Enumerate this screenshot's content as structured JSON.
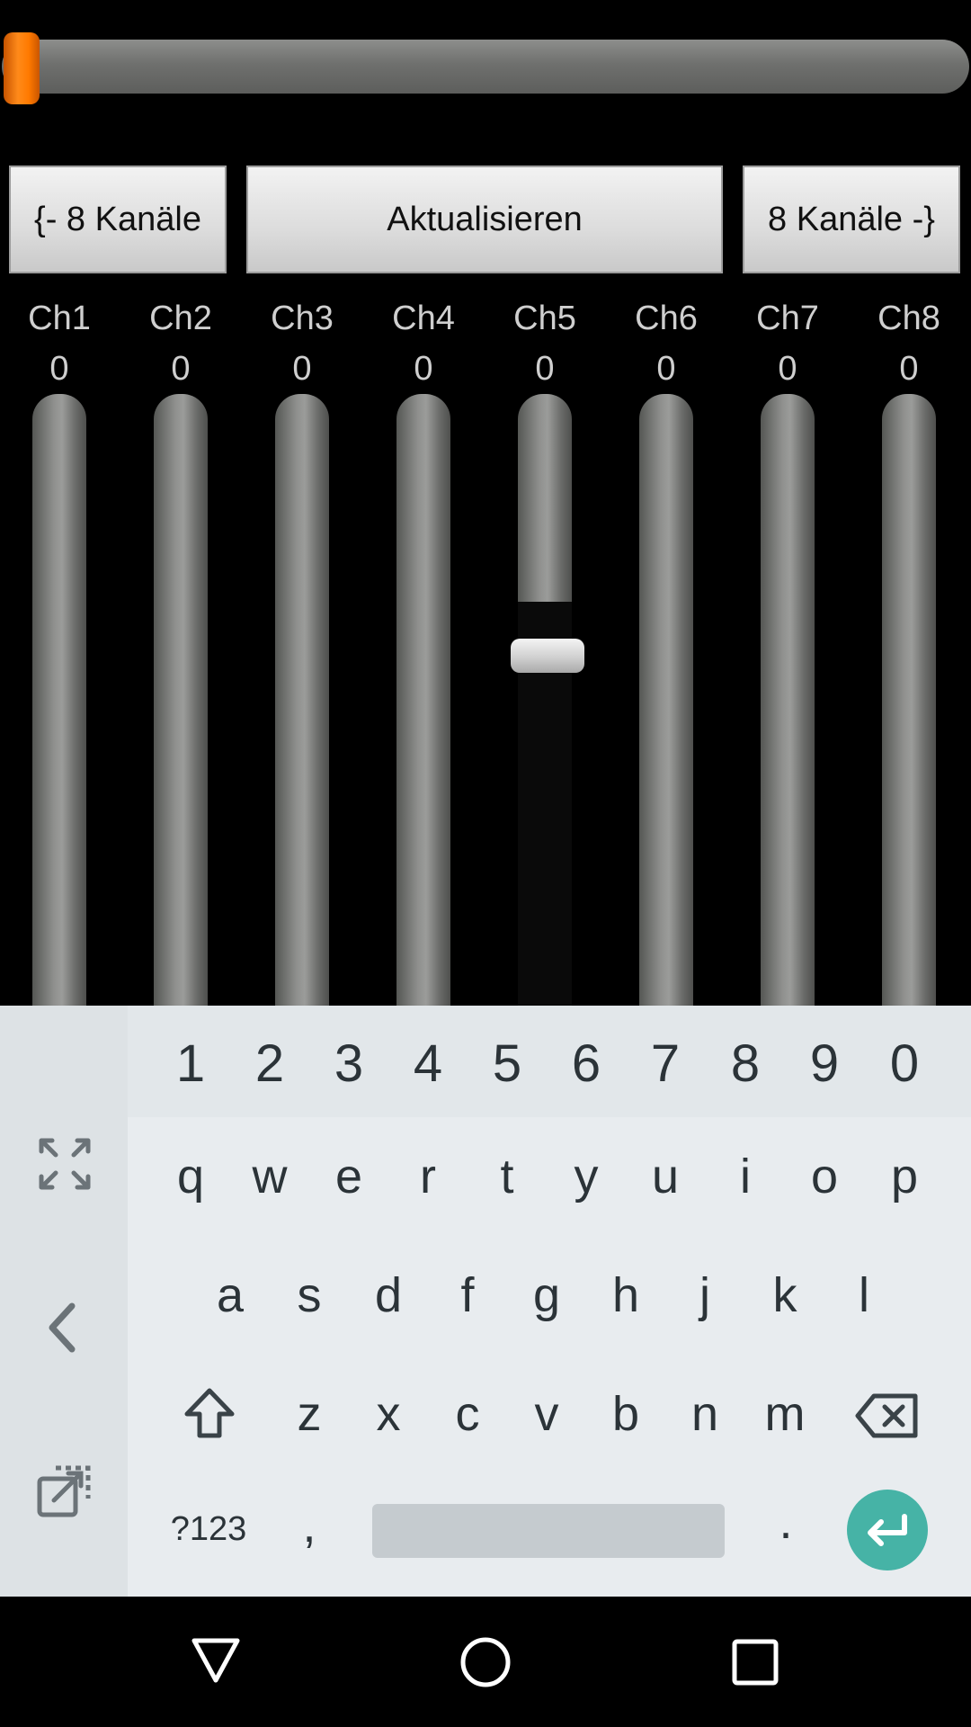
{
  "master_slider": {
    "value_fraction": 0.0
  },
  "buttons": {
    "prev": "{- 8 Kanäle",
    "refresh": "Aktualisieren",
    "next": "8 Kanäle -}"
  },
  "channels": [
    {
      "name": "Ch1",
      "value": "0"
    },
    {
      "name": "Ch2",
      "value": "0"
    },
    {
      "name": "Ch3",
      "value": "0"
    },
    {
      "name": "Ch4",
      "value": "0"
    },
    {
      "name": "Ch5",
      "value": "0"
    },
    {
      "name": "Ch6",
      "value": "0"
    },
    {
      "name": "Ch7",
      "value": "0"
    },
    {
      "name": "Ch8",
      "value": "0"
    }
  ],
  "keyboard": {
    "numbers": [
      "1",
      "2",
      "3",
      "4",
      "5",
      "6",
      "7",
      "8",
      "9",
      "0"
    ],
    "row1": [
      "q",
      "w",
      "e",
      "r",
      "t",
      "y",
      "u",
      "i",
      "o",
      "p"
    ],
    "row2": [
      "a",
      "s",
      "d",
      "f",
      "g",
      "h",
      "j",
      "k",
      "l"
    ],
    "row3": [
      "z",
      "x",
      "c",
      "v",
      "b",
      "n",
      "m"
    ],
    "symbols_key": "?123",
    "comma_key": ",",
    "period_key": ".",
    "side_icons": [
      "expand-icon",
      "chevron-left-icon",
      "floating-keyboard-icon"
    ]
  },
  "navbar": {
    "icons": [
      "back-icon",
      "home-icon",
      "recents-icon"
    ]
  }
}
